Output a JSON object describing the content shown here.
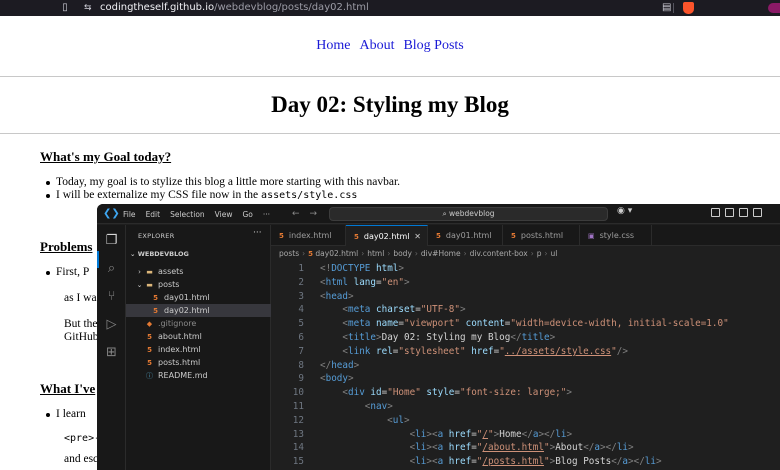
{
  "browser": {
    "url_host": "codingtheself.github.io",
    "url_path": "/webdevblog/posts/day02.html"
  },
  "blog": {
    "nav": [
      "Home",
      "About",
      "Blog Posts"
    ],
    "title": "Day 02: Styling my Blog",
    "goal_heading": "What's my Goal today?",
    "goal_bullet_1": "Today, my goal is to stylize this blog a little more starting with this navbar.",
    "goal_bullet_2_prefix": "I will be externalize my CSS file now in the ",
    "goal_bullet_2_code": "assets/style.css",
    "problems_heading": "Problems",
    "problems_bullet": "First, P",
    "problems_line_2": "as I wa",
    "problems_line_3": "But the",
    "problems_line_4": "GitHub",
    "learned_heading": "What I've",
    "learned_bullet": "I learn",
    "learned_line_2": "<pre>-",
    "learned_line_3": "and esc"
  },
  "vscode": {
    "menu": [
      "File",
      "Edit",
      "Selection",
      "View",
      "Go",
      "···"
    ],
    "search": "webdevblog",
    "explorer_title": "EXPLORER",
    "explorer_more": "···",
    "root": "WEBDEVBLOG",
    "tree": [
      {
        "name": "assets",
        "kind": "folder",
        "indent": 1,
        "expanded": false
      },
      {
        "name": "posts",
        "kind": "folder",
        "indent": 1,
        "expanded": true
      },
      {
        "name": "day01.html",
        "kind": "html",
        "indent": 2
      },
      {
        "name": "day02.html",
        "kind": "html",
        "indent": 2,
        "selected": true
      },
      {
        "name": ".gitignore",
        "kind": "git",
        "indent": 1
      },
      {
        "name": "about.html",
        "kind": "html",
        "indent": 1
      },
      {
        "name": "index.html",
        "kind": "html",
        "indent": 1
      },
      {
        "name": "posts.html",
        "kind": "html",
        "indent": 1
      },
      {
        "name": "README.md",
        "kind": "info",
        "indent": 1
      }
    ],
    "tabs": [
      {
        "name": "index.html",
        "kind": "html"
      },
      {
        "name": "day02.html",
        "kind": "html",
        "active": true
      },
      {
        "name": "day01.html",
        "kind": "html"
      },
      {
        "name": "posts.html",
        "kind": "html"
      },
      {
        "name": "style.css",
        "kind": "css"
      }
    ],
    "breadcrumb": [
      "posts",
      "day02.html",
      "html",
      "body",
      "div#Home",
      "div.content-box",
      "p",
      "ul"
    ],
    "code_lines": [
      {
        "n": "1",
        "tokens": [
          [
            "br",
            "<!"
          ],
          [
            "tag",
            "DOCTYPE"
          ],
          [
            "txt",
            " "
          ],
          [
            "at",
            "html"
          ],
          [
            "br",
            ">"
          ]
        ]
      },
      {
        "n": "2",
        "tokens": [
          [
            "br",
            "<"
          ],
          [
            "tag",
            "html"
          ],
          [
            "txt",
            " "
          ],
          [
            "at",
            "lang"
          ],
          [
            "txt",
            "="
          ],
          [
            "str",
            "\"en\""
          ],
          [
            "br",
            ">"
          ]
        ]
      },
      {
        "n": "3",
        "tokens": [
          [
            "br",
            "<"
          ],
          [
            "tag",
            "head"
          ],
          [
            "br",
            ">"
          ]
        ]
      },
      {
        "n": "4",
        "tokens": [
          [
            "txt",
            "    "
          ],
          [
            "br",
            "<"
          ],
          [
            "tag",
            "meta"
          ],
          [
            "txt",
            " "
          ],
          [
            "at",
            "charset"
          ],
          [
            "txt",
            "="
          ],
          [
            "str",
            "\"UTF-8\""
          ],
          [
            "br",
            ">"
          ]
        ]
      },
      {
        "n": "5",
        "tokens": [
          [
            "txt",
            "    "
          ],
          [
            "br",
            "<"
          ],
          [
            "tag",
            "meta"
          ],
          [
            "txt",
            " "
          ],
          [
            "at",
            "name"
          ],
          [
            "txt",
            "="
          ],
          [
            "str",
            "\"viewport\""
          ],
          [
            "txt",
            " "
          ],
          [
            "at",
            "content"
          ],
          [
            "txt",
            "="
          ],
          [
            "str",
            "\"width=device-width, initial-scale=1.0\""
          ]
        ]
      },
      {
        "n": "6",
        "tokens": [
          [
            "txt",
            "    "
          ],
          [
            "br",
            "<"
          ],
          [
            "tag",
            "title"
          ],
          [
            "br",
            ">"
          ],
          [
            "txt",
            "Day 02: Styling my Blog"
          ],
          [
            "br",
            "</"
          ],
          [
            "tag",
            "title"
          ],
          [
            "br",
            ">"
          ]
        ]
      },
      {
        "n": "7",
        "tokens": [
          [
            "txt",
            "    "
          ],
          [
            "br",
            "<"
          ],
          [
            "tag",
            "link"
          ],
          [
            "txt",
            " "
          ],
          [
            "at",
            "rel"
          ],
          [
            "txt",
            "="
          ],
          [
            "str",
            "\"stylesheet\""
          ],
          [
            "txt",
            " "
          ],
          [
            "at",
            "href"
          ],
          [
            "txt",
            "="
          ],
          [
            "str",
            "\""
          ],
          [
            "stru",
            "../assets/style.css"
          ],
          [
            "str",
            "\""
          ],
          [
            "br",
            "/>"
          ]
        ]
      },
      {
        "n": "8",
        "tokens": [
          [
            "br",
            "</"
          ],
          [
            "tag",
            "head"
          ],
          [
            "br",
            ">"
          ]
        ]
      },
      {
        "n": "9",
        "tokens": [
          [
            "br",
            "<"
          ],
          [
            "tag",
            "body"
          ],
          [
            "br",
            ">"
          ]
        ]
      },
      {
        "n": "10",
        "tokens": [
          [
            "txt",
            "    "
          ],
          [
            "br",
            "<"
          ],
          [
            "tag",
            "div"
          ],
          [
            "txt",
            " "
          ],
          [
            "at",
            "id"
          ],
          [
            "txt",
            "="
          ],
          [
            "str",
            "\"Home\""
          ],
          [
            "txt",
            " "
          ],
          [
            "at",
            "style"
          ],
          [
            "txt",
            "="
          ],
          [
            "str",
            "\"font-size: large;\""
          ],
          [
            "br",
            ">"
          ]
        ]
      },
      {
        "n": "11",
        "tokens": [
          [
            "txt",
            "        "
          ],
          [
            "br",
            "<"
          ],
          [
            "tag",
            "nav"
          ],
          [
            "br",
            ">"
          ]
        ]
      },
      {
        "n": "12",
        "tokens": [
          [
            "txt",
            "            "
          ],
          [
            "br",
            "<"
          ],
          [
            "tag",
            "ul"
          ],
          [
            "br",
            ">"
          ]
        ]
      },
      {
        "n": "13",
        "tokens": [
          [
            "txt",
            "                "
          ],
          [
            "br",
            "<"
          ],
          [
            "tag",
            "li"
          ],
          [
            "br",
            "><"
          ],
          [
            "tag",
            "a"
          ],
          [
            "txt",
            " "
          ],
          [
            "at",
            "href"
          ],
          [
            "txt",
            "="
          ],
          [
            "str",
            "\""
          ],
          [
            "stru",
            "/"
          ],
          [
            "str",
            "\""
          ],
          [
            "br",
            ">"
          ],
          [
            "txt",
            "Home"
          ],
          [
            "br",
            "</"
          ],
          [
            "tag",
            "a"
          ],
          [
            "br",
            "></"
          ],
          [
            "tag",
            "li"
          ],
          [
            "br",
            ">"
          ]
        ]
      },
      {
        "n": "14",
        "tokens": [
          [
            "txt",
            "                "
          ],
          [
            "br",
            "<"
          ],
          [
            "tag",
            "li"
          ],
          [
            "br",
            "><"
          ],
          [
            "tag",
            "a"
          ],
          [
            "txt",
            " "
          ],
          [
            "at",
            "href"
          ],
          [
            "txt",
            "="
          ],
          [
            "str",
            "\""
          ],
          [
            "stru",
            "/about.html"
          ],
          [
            "str",
            "\""
          ],
          [
            "br",
            ">"
          ],
          [
            "txt",
            "About"
          ],
          [
            "br",
            "</"
          ],
          [
            "tag",
            "a"
          ],
          [
            "br",
            "></"
          ],
          [
            "tag",
            "li"
          ],
          [
            "br",
            ">"
          ]
        ]
      },
      {
        "n": "15",
        "tokens": [
          [
            "txt",
            "                "
          ],
          [
            "br",
            "<"
          ],
          [
            "tag",
            "li"
          ],
          [
            "br",
            "><"
          ],
          [
            "tag",
            "a"
          ],
          [
            "txt",
            " "
          ],
          [
            "at",
            "href"
          ],
          [
            "txt",
            "="
          ],
          [
            "str",
            "\""
          ],
          [
            "stru",
            "/posts.html"
          ],
          [
            "str",
            "\""
          ],
          [
            "br",
            ">"
          ],
          [
            "txt",
            "Blog Posts"
          ],
          [
            "br",
            "</"
          ],
          [
            "tag",
            "a"
          ],
          [
            "br",
            "></"
          ],
          [
            "tag",
            "li"
          ],
          [
            "br",
            ">"
          ]
        ]
      }
    ]
  }
}
